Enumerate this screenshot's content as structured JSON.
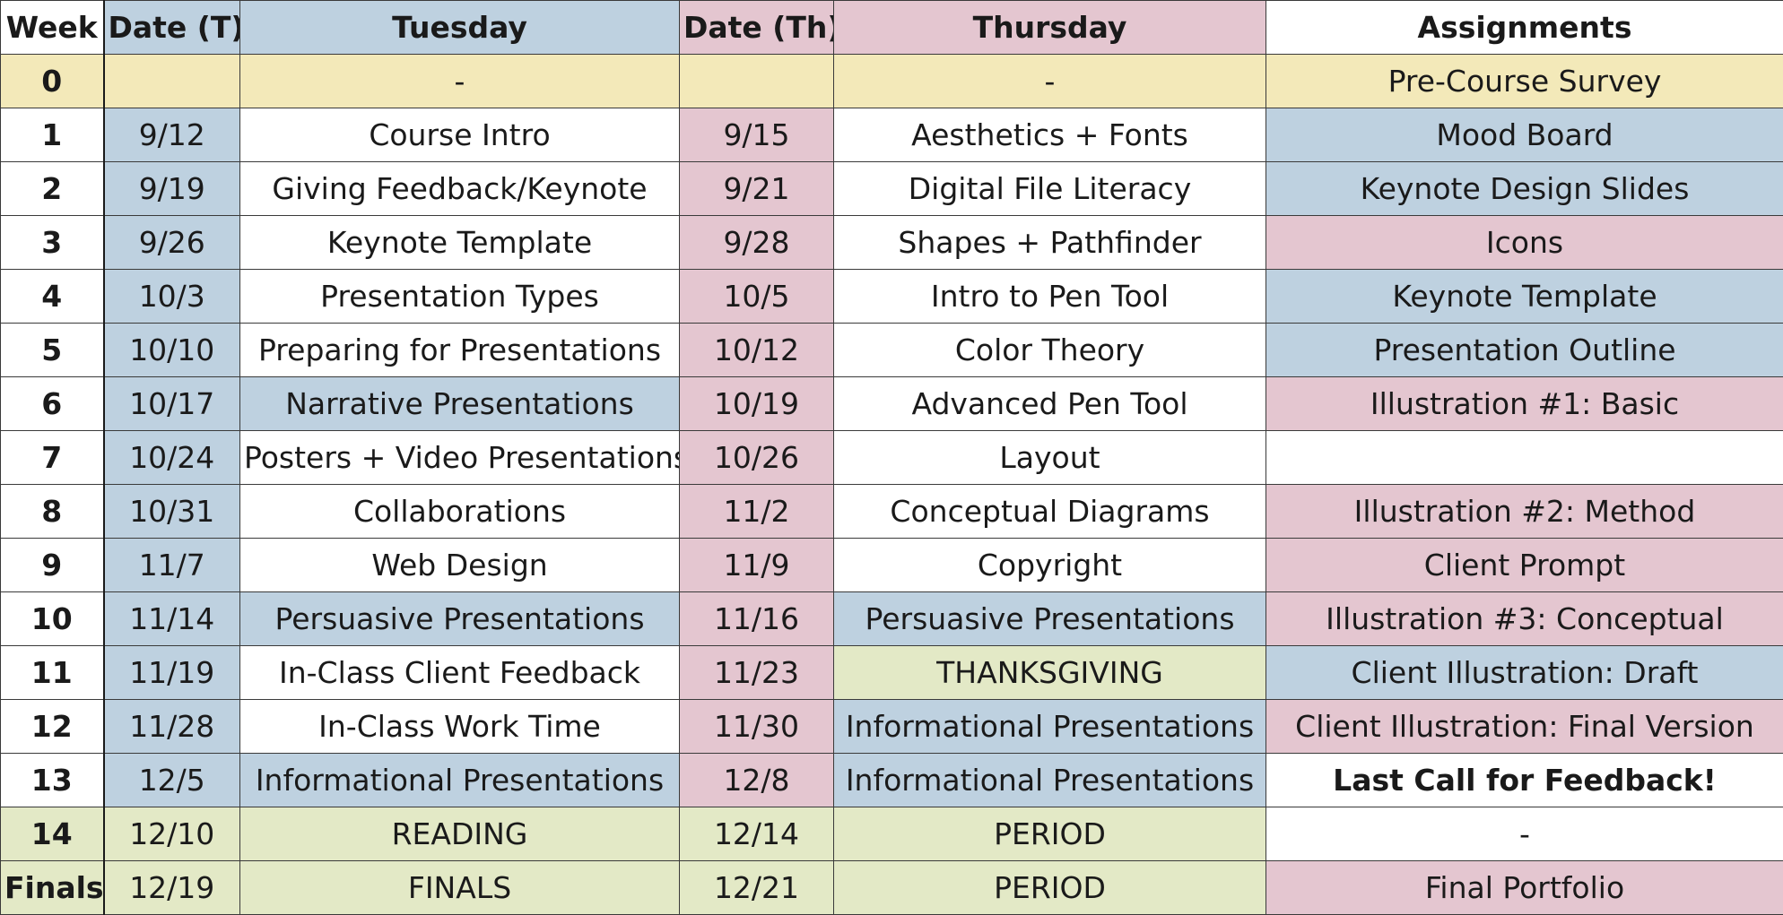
{
  "colors": {
    "white": "#ffffff",
    "blue": "#bed1e0",
    "pink": "#e4c6d0",
    "yellow": "#f3e9b9",
    "green": "#e3e9c6"
  },
  "headers": [
    {
      "text": "Week",
      "bg": "white"
    },
    {
      "text": "Date (T)",
      "bg": "blue"
    },
    {
      "text": "Tuesday",
      "bg": "blue"
    },
    {
      "text": "Date (Th)",
      "bg": "pink"
    },
    {
      "text": "Thursday",
      "bg": "pink"
    },
    {
      "text": "Assignments",
      "bg": "white"
    }
  ],
  "rows": [
    {
      "week": "0",
      "week_bg": "yellow",
      "cells": [
        {
          "text": "",
          "bg": "yellow"
        },
        {
          "text": "-",
          "bg": "yellow"
        },
        {
          "text": "",
          "bg": "yellow"
        },
        {
          "text": "-",
          "bg": "yellow"
        },
        {
          "text": "Pre-Course Survey",
          "bg": "yellow"
        }
      ]
    },
    {
      "week": "1",
      "week_bg": "white",
      "cells": [
        {
          "text": "9/12",
          "bg": "blue"
        },
        {
          "text": "Course Intro",
          "bg": "white"
        },
        {
          "text": "9/15",
          "bg": "pink"
        },
        {
          "text": "Aesthetics + Fonts",
          "bg": "white"
        },
        {
          "text": "Mood Board",
          "bg": "blue"
        }
      ]
    },
    {
      "week": "2",
      "week_bg": "white",
      "cells": [
        {
          "text": "9/19",
          "bg": "blue"
        },
        {
          "text": "Giving Feedback/Keynote",
          "bg": "white"
        },
        {
          "text": "9/21",
          "bg": "pink"
        },
        {
          "text": "Digital File Literacy",
          "bg": "white"
        },
        {
          "text": "Keynote Design Slides",
          "bg": "blue"
        }
      ]
    },
    {
      "week": "3",
      "week_bg": "white",
      "cells": [
        {
          "text": "9/26",
          "bg": "blue"
        },
        {
          "text": "Keynote Template",
          "bg": "white"
        },
        {
          "text": "9/28",
          "bg": "pink"
        },
        {
          "text": "Shapes + Pathfinder",
          "bg": "white"
        },
        {
          "text": "Icons",
          "bg": "pink"
        }
      ]
    },
    {
      "week": "4",
      "week_bg": "white",
      "cells": [
        {
          "text": "10/3",
          "bg": "blue"
        },
        {
          "text": "Presentation Types",
          "bg": "white"
        },
        {
          "text": "10/5",
          "bg": "pink"
        },
        {
          "text": "Intro to Pen Tool",
          "bg": "white"
        },
        {
          "text": "Keynote Template",
          "bg": "blue"
        }
      ]
    },
    {
      "week": "5",
      "week_bg": "white",
      "cells": [
        {
          "text": "10/10",
          "bg": "blue"
        },
        {
          "text": "Preparing for Presentations",
          "bg": "white"
        },
        {
          "text": "10/12",
          "bg": "pink"
        },
        {
          "text": "Color Theory",
          "bg": "white"
        },
        {
          "text": "Presentation Outline",
          "bg": "blue"
        }
      ]
    },
    {
      "week": "6",
      "week_bg": "white",
      "cells": [
        {
          "text": "10/17",
          "bg": "blue"
        },
        {
          "text": "Narrative Presentations",
          "bg": "blue"
        },
        {
          "text": "10/19",
          "bg": "pink"
        },
        {
          "text": "Advanced Pen Tool",
          "bg": "white"
        },
        {
          "text": "Illustration #1: Basic",
          "bg": "pink"
        }
      ]
    },
    {
      "week": "7",
      "week_bg": "white",
      "cells": [
        {
          "text": "10/24",
          "bg": "blue"
        },
        {
          "text": "Posters + Video Presentations",
          "bg": "white"
        },
        {
          "text": "10/26",
          "bg": "pink"
        },
        {
          "text": "Layout",
          "bg": "white"
        },
        {
          "text": "",
          "bg": "white"
        }
      ]
    },
    {
      "week": "8",
      "week_bg": "white",
      "cells": [
        {
          "text": "10/31",
          "bg": "blue"
        },
        {
          "text": "Collaborations",
          "bg": "white"
        },
        {
          "text": "11/2",
          "bg": "pink"
        },
        {
          "text": "Conceptual Diagrams",
          "bg": "white"
        },
        {
          "text": "Illustration #2: Method",
          "bg": "pink"
        }
      ]
    },
    {
      "week": "9",
      "week_bg": "white",
      "cells": [
        {
          "text": "11/7",
          "bg": "blue"
        },
        {
          "text": "Web Design",
          "bg": "white"
        },
        {
          "text": "11/9",
          "bg": "pink"
        },
        {
          "text": "Copyright",
          "bg": "white"
        },
        {
          "text": "Client Prompt",
          "bg": "pink"
        }
      ]
    },
    {
      "week": "10",
      "week_bg": "white",
      "cells": [
        {
          "text": "11/14",
          "bg": "blue"
        },
        {
          "text": "Persuasive Presentations",
          "bg": "blue"
        },
        {
          "text": "11/16",
          "bg": "pink"
        },
        {
          "text": "Persuasive Presentations",
          "bg": "blue"
        },
        {
          "text": "Illustration #3: Conceptual",
          "bg": "pink"
        }
      ]
    },
    {
      "week": "11",
      "week_bg": "white",
      "cells": [
        {
          "text": "11/19",
          "bg": "blue"
        },
        {
          "text": "In-Class Client Feedback",
          "bg": "white"
        },
        {
          "text": "11/23",
          "bg": "pink"
        },
        {
          "text": "THANKSGIVING",
          "bg": "green"
        },
        {
          "text": "Client Illustration: Draft",
          "bg": "blue"
        }
      ]
    },
    {
      "week": "12",
      "week_bg": "white",
      "cells": [
        {
          "text": "11/28",
          "bg": "blue"
        },
        {
          "text": "In-Class Work Time",
          "bg": "white"
        },
        {
          "text": "11/30",
          "bg": "pink"
        },
        {
          "text": "Informational Presentations",
          "bg": "blue"
        },
        {
          "text": "Client Illustration: Final Version",
          "bg": "pink"
        }
      ]
    },
    {
      "week": "13",
      "week_bg": "white",
      "cells": [
        {
          "text": "12/5",
          "bg": "blue"
        },
        {
          "text": "Informational Presentations",
          "bg": "blue"
        },
        {
          "text": "12/8",
          "bg": "pink"
        },
        {
          "text": "Informational Presentations",
          "bg": "blue"
        },
        {
          "text": "Last Call for Feedback!",
          "bg": "white",
          "bold": true
        }
      ]
    },
    {
      "week": "14",
      "week_bg": "green",
      "cells": [
        {
          "text": "12/10",
          "bg": "green"
        },
        {
          "text": "READING",
          "bg": "green"
        },
        {
          "text": "12/14",
          "bg": "green"
        },
        {
          "text": "PERIOD",
          "bg": "green"
        },
        {
          "text": "-",
          "bg": "white"
        }
      ]
    },
    {
      "week": "Finals",
      "week_bg": "green",
      "cells": [
        {
          "text": "12/19",
          "bg": "green"
        },
        {
          "text": "FINALS",
          "bg": "green"
        },
        {
          "text": "12/21",
          "bg": "green"
        },
        {
          "text": "PERIOD",
          "bg": "green"
        },
        {
          "text": "Final Portfolio",
          "bg": "pink"
        }
      ]
    }
  ]
}
